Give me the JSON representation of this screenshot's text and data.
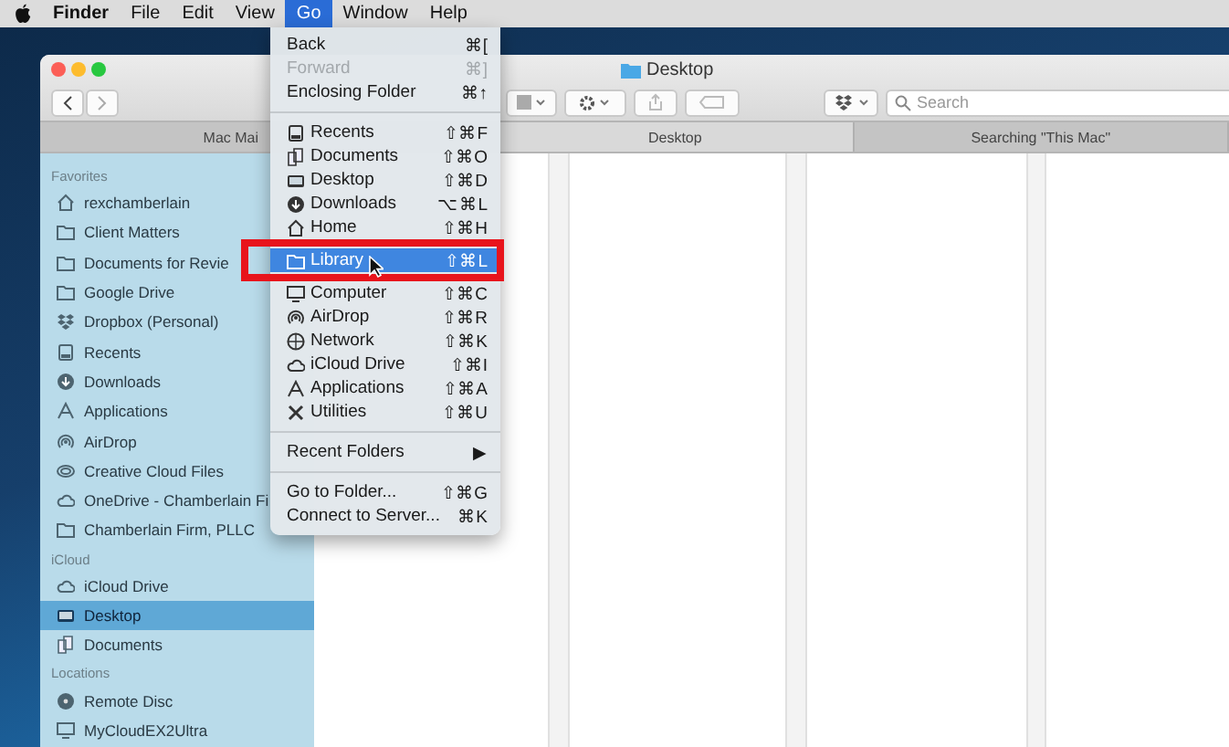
{
  "menu_bar": [
    {
      "kind": "apple",
      "selected": false
    },
    {
      "kind": "app",
      "label": "Finder",
      "selected": false
    },
    {
      "kind": "menu",
      "label": "File",
      "selected": false
    },
    {
      "kind": "menu",
      "label": "Edit",
      "selected": false
    },
    {
      "kind": "menu",
      "label": "View",
      "selected": false
    },
    {
      "kind": "menu",
      "label": "Go",
      "selected": true
    },
    {
      "kind": "menu",
      "label": "Window",
      "selected": false
    },
    {
      "kind": "menu",
      "label": "Help",
      "selected": false
    }
  ],
  "window": {
    "title": "Desktop",
    "toolbar": {
      "search": {
        "placeholder": "Search"
      }
    },
    "tabs": [
      {
        "label": "Mac Mai",
        "selected": false
      },
      {
        "label": "Desktop",
        "selected": true
      },
      {
        "label": "Searching \"This Mac\"",
        "selected": false
      }
    ],
    "sidebar": [
      {
        "heading": "Favorites",
        "items": [
          {
            "label": "rexchamberlain",
            "selected": false
          },
          {
            "label": "Client Matters",
            "selected": false
          },
          {
            "label": "Documents for Revie",
            "selected": false
          },
          {
            "label": "Google Drive",
            "selected": false
          },
          {
            "label": "Dropbox (Personal)",
            "selected": false
          },
          {
            "label": "Recents",
            "selected": false
          },
          {
            "label": "Downloads",
            "selected": false
          },
          {
            "label": "Applications",
            "selected": false
          },
          {
            "label": "AirDrop",
            "selected": false
          },
          {
            "label": "Creative Cloud Files",
            "selected": false
          },
          {
            "label": "OneDrive - Chamberlain Fi",
            "selected": false
          },
          {
            "label": "Chamberlain Firm, PLLC",
            "selected": false
          }
        ]
      },
      {
        "heading": "iCloud",
        "items": [
          {
            "label": "iCloud Drive",
            "selected": false
          },
          {
            "label": "Desktop",
            "selected": true
          },
          {
            "label": "Documents",
            "selected": false
          }
        ]
      },
      {
        "heading": "Locations",
        "items": [
          {
            "label": "Remote Disc",
            "selected": false
          },
          {
            "label": "MyCloudEX2Ultra",
            "selected": false
          }
        ]
      }
    ]
  },
  "go_menu": [
    {
      "kind": "item",
      "label": "Back",
      "shortcut": "⌘[",
      "disabled": false,
      "selected": false
    },
    {
      "kind": "item",
      "label": "Forward",
      "shortcut": "⌘]",
      "disabled": true,
      "selected": false
    },
    {
      "kind": "item",
      "label": "Enclosing Folder",
      "shortcut": "⌘↑",
      "disabled": false,
      "selected": false
    },
    {
      "kind": "separator"
    },
    {
      "kind": "item",
      "label": "Recents",
      "shortcut": "⇧⌘F",
      "disabled": false,
      "selected": false
    },
    {
      "kind": "item",
      "label": "Documents",
      "shortcut": "⇧⌘O",
      "disabled": false,
      "selected": false
    },
    {
      "kind": "item",
      "label": "Desktop",
      "shortcut": "⇧⌘D",
      "disabled": false,
      "selected": false
    },
    {
      "kind": "item",
      "label": "Downloads",
      "shortcut": "⌥⌘L",
      "disabled": false,
      "selected": false
    },
    {
      "kind": "item",
      "label": "Home",
      "shortcut": "⇧⌘H",
      "disabled": false,
      "selected": false
    },
    {
      "kind": "item",
      "label": "Library",
      "shortcut": "⇧⌘L",
      "disabled": false,
      "selected": true
    },
    {
      "kind": "item",
      "label": "Computer",
      "shortcut": "⇧⌘C",
      "disabled": false,
      "selected": false
    },
    {
      "kind": "item",
      "label": "AirDrop",
      "shortcut": "⇧⌘R",
      "disabled": false,
      "selected": false
    },
    {
      "kind": "item",
      "label": "Network",
      "shortcut": "⇧⌘K",
      "disabled": false,
      "selected": false
    },
    {
      "kind": "item",
      "label": "iCloud Drive",
      "shortcut": "⇧⌘I",
      "disabled": false,
      "selected": false
    },
    {
      "kind": "item",
      "label": "Applications",
      "shortcut": "⇧⌘A",
      "disabled": false,
      "selected": false
    },
    {
      "kind": "item",
      "label": "Utilities",
      "shortcut": "⇧⌘U",
      "disabled": false,
      "selected": false
    },
    {
      "kind": "separator"
    },
    {
      "kind": "submenu",
      "label": "Recent Folders",
      "shortcut": "▶",
      "disabled": false,
      "selected": false
    },
    {
      "kind": "separator"
    },
    {
      "kind": "item",
      "label": "Go to Folder...",
      "shortcut": "⇧⌘G",
      "disabled": false,
      "selected": false
    },
    {
      "kind": "item",
      "label": "Connect to Server...",
      "shortcut": "⌘K",
      "disabled": false,
      "selected": false
    }
  ]
}
